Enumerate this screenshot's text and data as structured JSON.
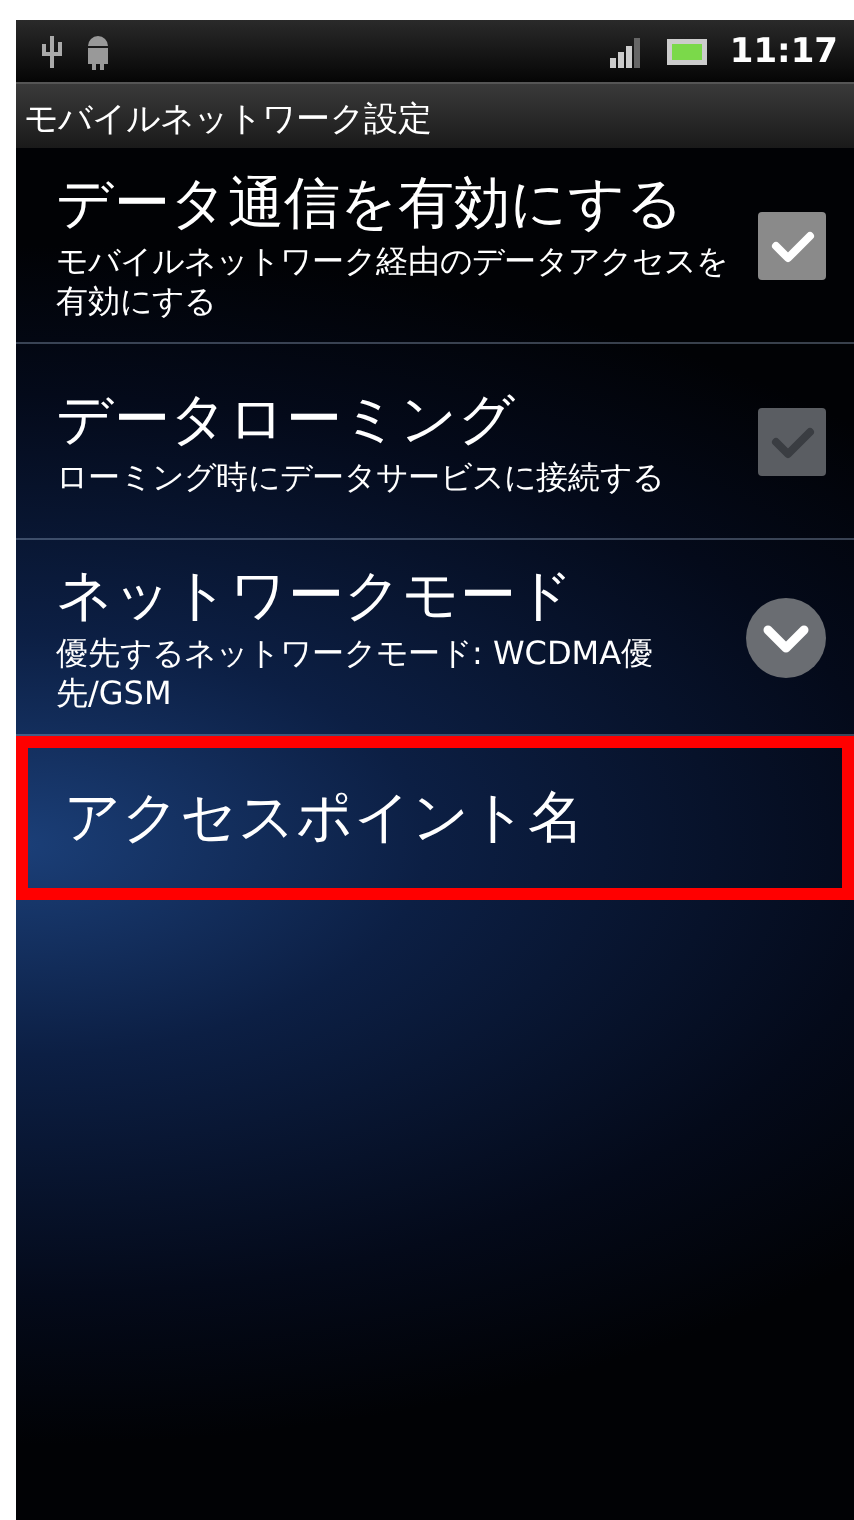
{
  "status_bar": {
    "time": "11:17"
  },
  "title_bar": {
    "title": "モバイルネットワーク設定"
  },
  "settings": [
    {
      "kind": "checkbox",
      "title": "データ通信を有効にする",
      "summary": "モバイルネットワーク経由のデータアクセスを有効にする",
      "checked": true,
      "highlighted": false
    },
    {
      "kind": "checkbox",
      "title": "データローミング",
      "summary": "ローミング時にデータサービスに接続する",
      "checked": false,
      "highlighted": false
    },
    {
      "kind": "dropdown",
      "title": "ネットワークモード",
      "summary": "優先するネットワークモード: WCDMA優先/GSM",
      "highlighted": false
    },
    {
      "kind": "plain",
      "title": "アクセスポイント名",
      "highlighted": true
    }
  ]
}
